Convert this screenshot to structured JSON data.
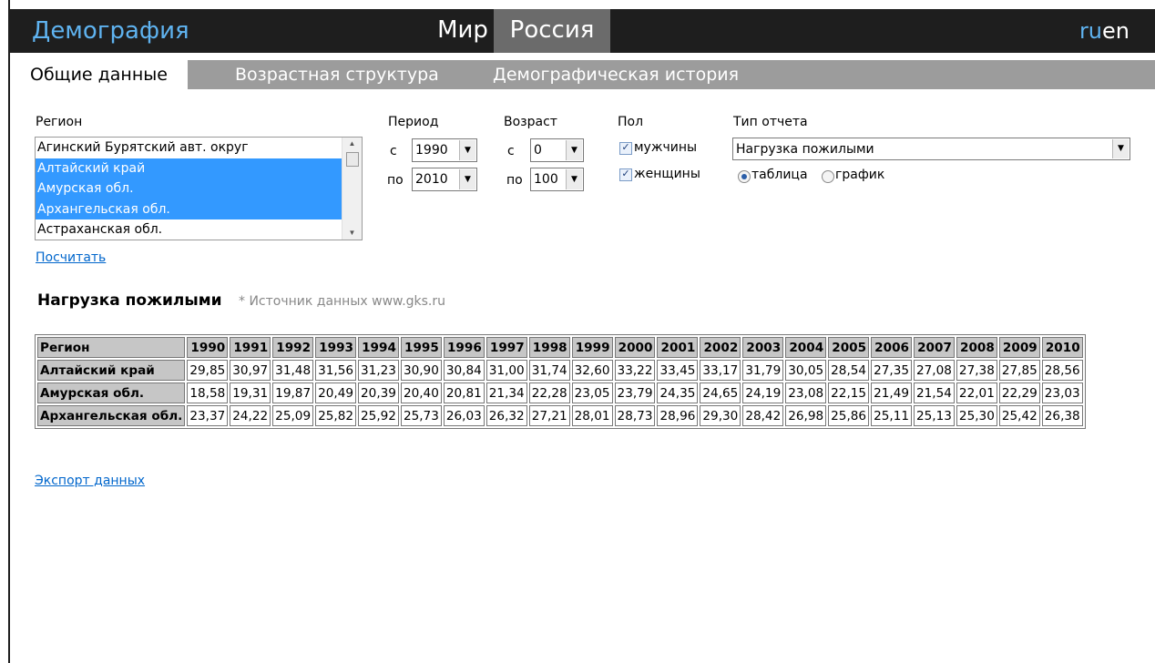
{
  "header": {
    "brand": "Демография",
    "tabs": [
      "Мир",
      "Россия"
    ],
    "lang_ru": "ru",
    "lang_en": "en"
  },
  "subtabs": [
    "Общие данные",
    "Возрастная структура",
    "Демографическая история"
  ],
  "form": {
    "region_label": "Регион",
    "regions": [
      {
        "name": "Агинский Бурятский авт. округ",
        "selected": false
      },
      {
        "name": "Алтайский край",
        "selected": true
      },
      {
        "name": "Амурская обл.",
        "selected": true
      },
      {
        "name": "Архангельская обл.",
        "selected": true
      },
      {
        "name": "Астраханская обл.",
        "selected": false
      }
    ],
    "period_label": "Период",
    "from_label": "с",
    "to_label": "по",
    "period_from": "1990",
    "period_to": "2010",
    "age_label": "Возраст",
    "age_from": "0",
    "age_to": "100",
    "sex_label": "Пол",
    "male_label": "мужчины",
    "female_label": "женщины",
    "male_checked": true,
    "female_checked": true,
    "report_type_label": "Тип отчета",
    "report_type_value": "Нагрузка пожилыми",
    "view_table_label": "таблица",
    "view_chart_label": "график",
    "view_selected": "таблица",
    "calculate_link": "Посчитать"
  },
  "report": {
    "title": "Нагрузка пожилыми",
    "source": "* Источник данных www.gks.ru"
  },
  "table": {
    "region_header": "Регион",
    "years": [
      "1990",
      "1991",
      "1992",
      "1993",
      "1994",
      "1995",
      "1996",
      "1997",
      "1998",
      "1999",
      "2000",
      "2001",
      "2002",
      "2003",
      "2004",
      "2005",
      "2006",
      "2007",
      "2008",
      "2009",
      "2010"
    ],
    "rows": [
      {
        "region": "Алтайский край",
        "values": [
          "29,85",
          "30,97",
          "31,48",
          "31,56",
          "31,23",
          "30,90",
          "30,84",
          "31,00",
          "31,74",
          "32,60",
          "33,22",
          "33,45",
          "33,17",
          "31,79",
          "30,05",
          "28,54",
          "27,35",
          "27,08",
          "27,38",
          "27,85",
          "28,56"
        ]
      },
      {
        "region": "Амурская обл.",
        "values": [
          "18,58",
          "19,31",
          "19,87",
          "20,49",
          "20,39",
          "20,40",
          "20,81",
          "21,34",
          "22,28",
          "23,05",
          "23,79",
          "24,35",
          "24,65",
          "24,19",
          "23,08",
          "22,15",
          "21,49",
          "21,54",
          "22,01",
          "22,29",
          "23,03"
        ]
      },
      {
        "region": "Архангельская обл.",
        "values": [
          "23,37",
          "24,22",
          "25,09",
          "25,82",
          "25,92",
          "25,73",
          "26,03",
          "26,32",
          "27,21",
          "28,01",
          "28,73",
          "28,96",
          "29,30",
          "28,42",
          "26,98",
          "25,86",
          "25,11",
          "25,13",
          "25,30",
          "25,42",
          "26,38"
        ]
      }
    ]
  },
  "export_link": "Экспорт данных"
}
